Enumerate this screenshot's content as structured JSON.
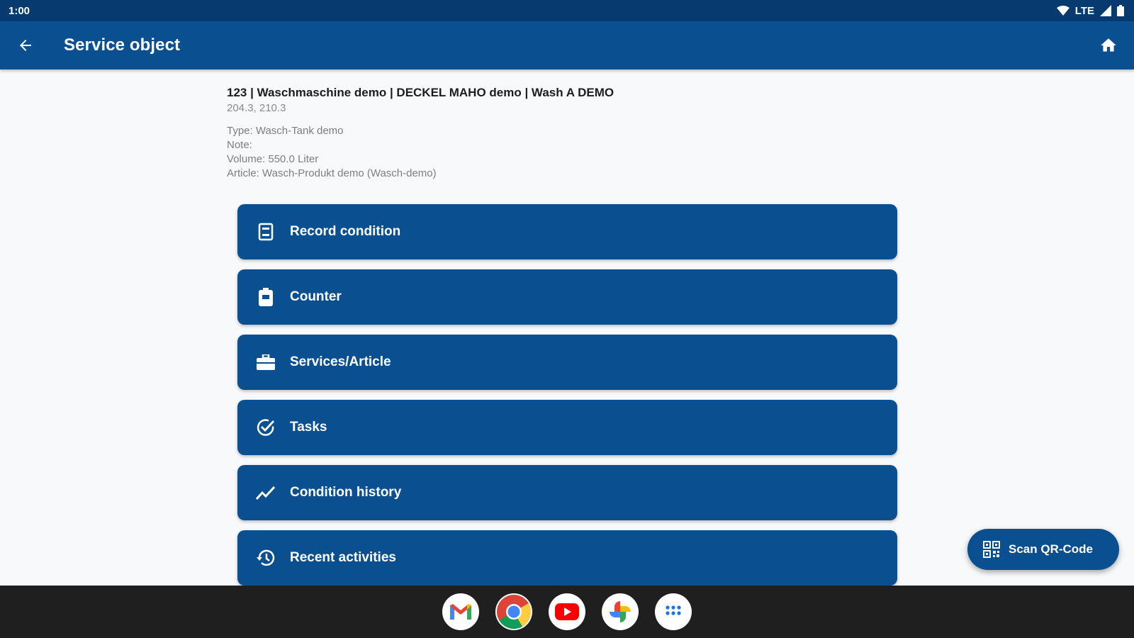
{
  "status_bar": {
    "time": "1:00",
    "network": "LTE"
  },
  "app_bar": {
    "title": "Service object",
    "back_icon": "arrow-left-icon",
    "home_icon": "home-icon"
  },
  "object": {
    "heading": "123 | Waschmaschine demo | DECKEL MAHO demo | Wash A DEMO",
    "codes": "204.3, 210.3",
    "details": [
      "Type: Wasch-Tank demo",
      "Note:",
      "Volume: 550.0 Liter",
      "Article: Wasch-Produkt demo (Wasch-demo)"
    ]
  },
  "menu": [
    {
      "label": "Record condition",
      "icon": "clipboard-icon"
    },
    {
      "label": "Counter",
      "icon": "counter-icon"
    },
    {
      "label": "Services/Article",
      "icon": "briefcase-icon"
    },
    {
      "label": "Tasks",
      "icon": "check-circle-icon"
    },
    {
      "label": "Condition history",
      "icon": "trend-icon"
    },
    {
      "label": "Recent activities",
      "icon": "history-icon"
    }
  ],
  "fab": {
    "label": "Scan QR-Code",
    "icon": "qr-code-icon"
  },
  "taskbar": {
    "apps": [
      "gmail-icon",
      "chrome-icon",
      "youtube-icon",
      "photos-icon",
      "app-drawer-icon"
    ]
  },
  "colors": {
    "primary": "#0a5091",
    "status_bar": "#073a6e",
    "background": "#f8f9fa",
    "taskbar": "#1f1f1f"
  }
}
